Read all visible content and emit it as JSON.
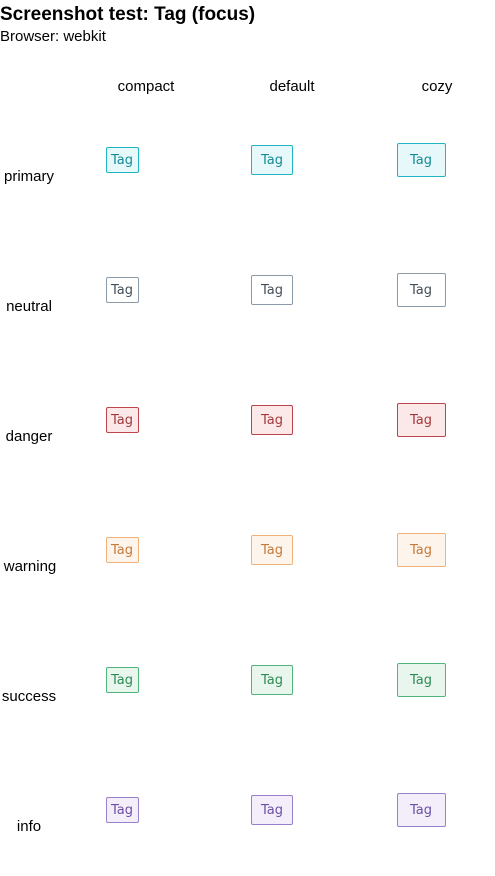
{
  "header": {
    "title": "Screenshot test: Tag (focus)",
    "browser": "Browser: webkit"
  },
  "columns": [
    "compact",
    "default",
    "cozy"
  ],
  "tag_label": "Tag",
  "rows": [
    {
      "label": "primary",
      "border": "#1fb5c2",
      "bg": "#e6f8fa",
      "text": "#148a95"
    },
    {
      "label": "neutral",
      "border": "#8a9aa8",
      "bg": "#ffffff",
      "text": "#444e58"
    },
    {
      "label": "danger",
      "border": "#c0454a",
      "bg": "#fbe9e9",
      "text": "#a3383c"
    },
    {
      "label": "warning",
      "border": "#f0b27a",
      "bg": "#fdf4ec",
      "text": "#c47a3a"
    },
    {
      "label": "success",
      "border": "#4fb57a",
      "bg": "#e8f6ed",
      "text": "#2e8a55"
    },
    {
      "label": "info",
      "border": "#9a7fc9",
      "bg": "#f3eefa",
      "text": "#6c4fa6"
    }
  ]
}
